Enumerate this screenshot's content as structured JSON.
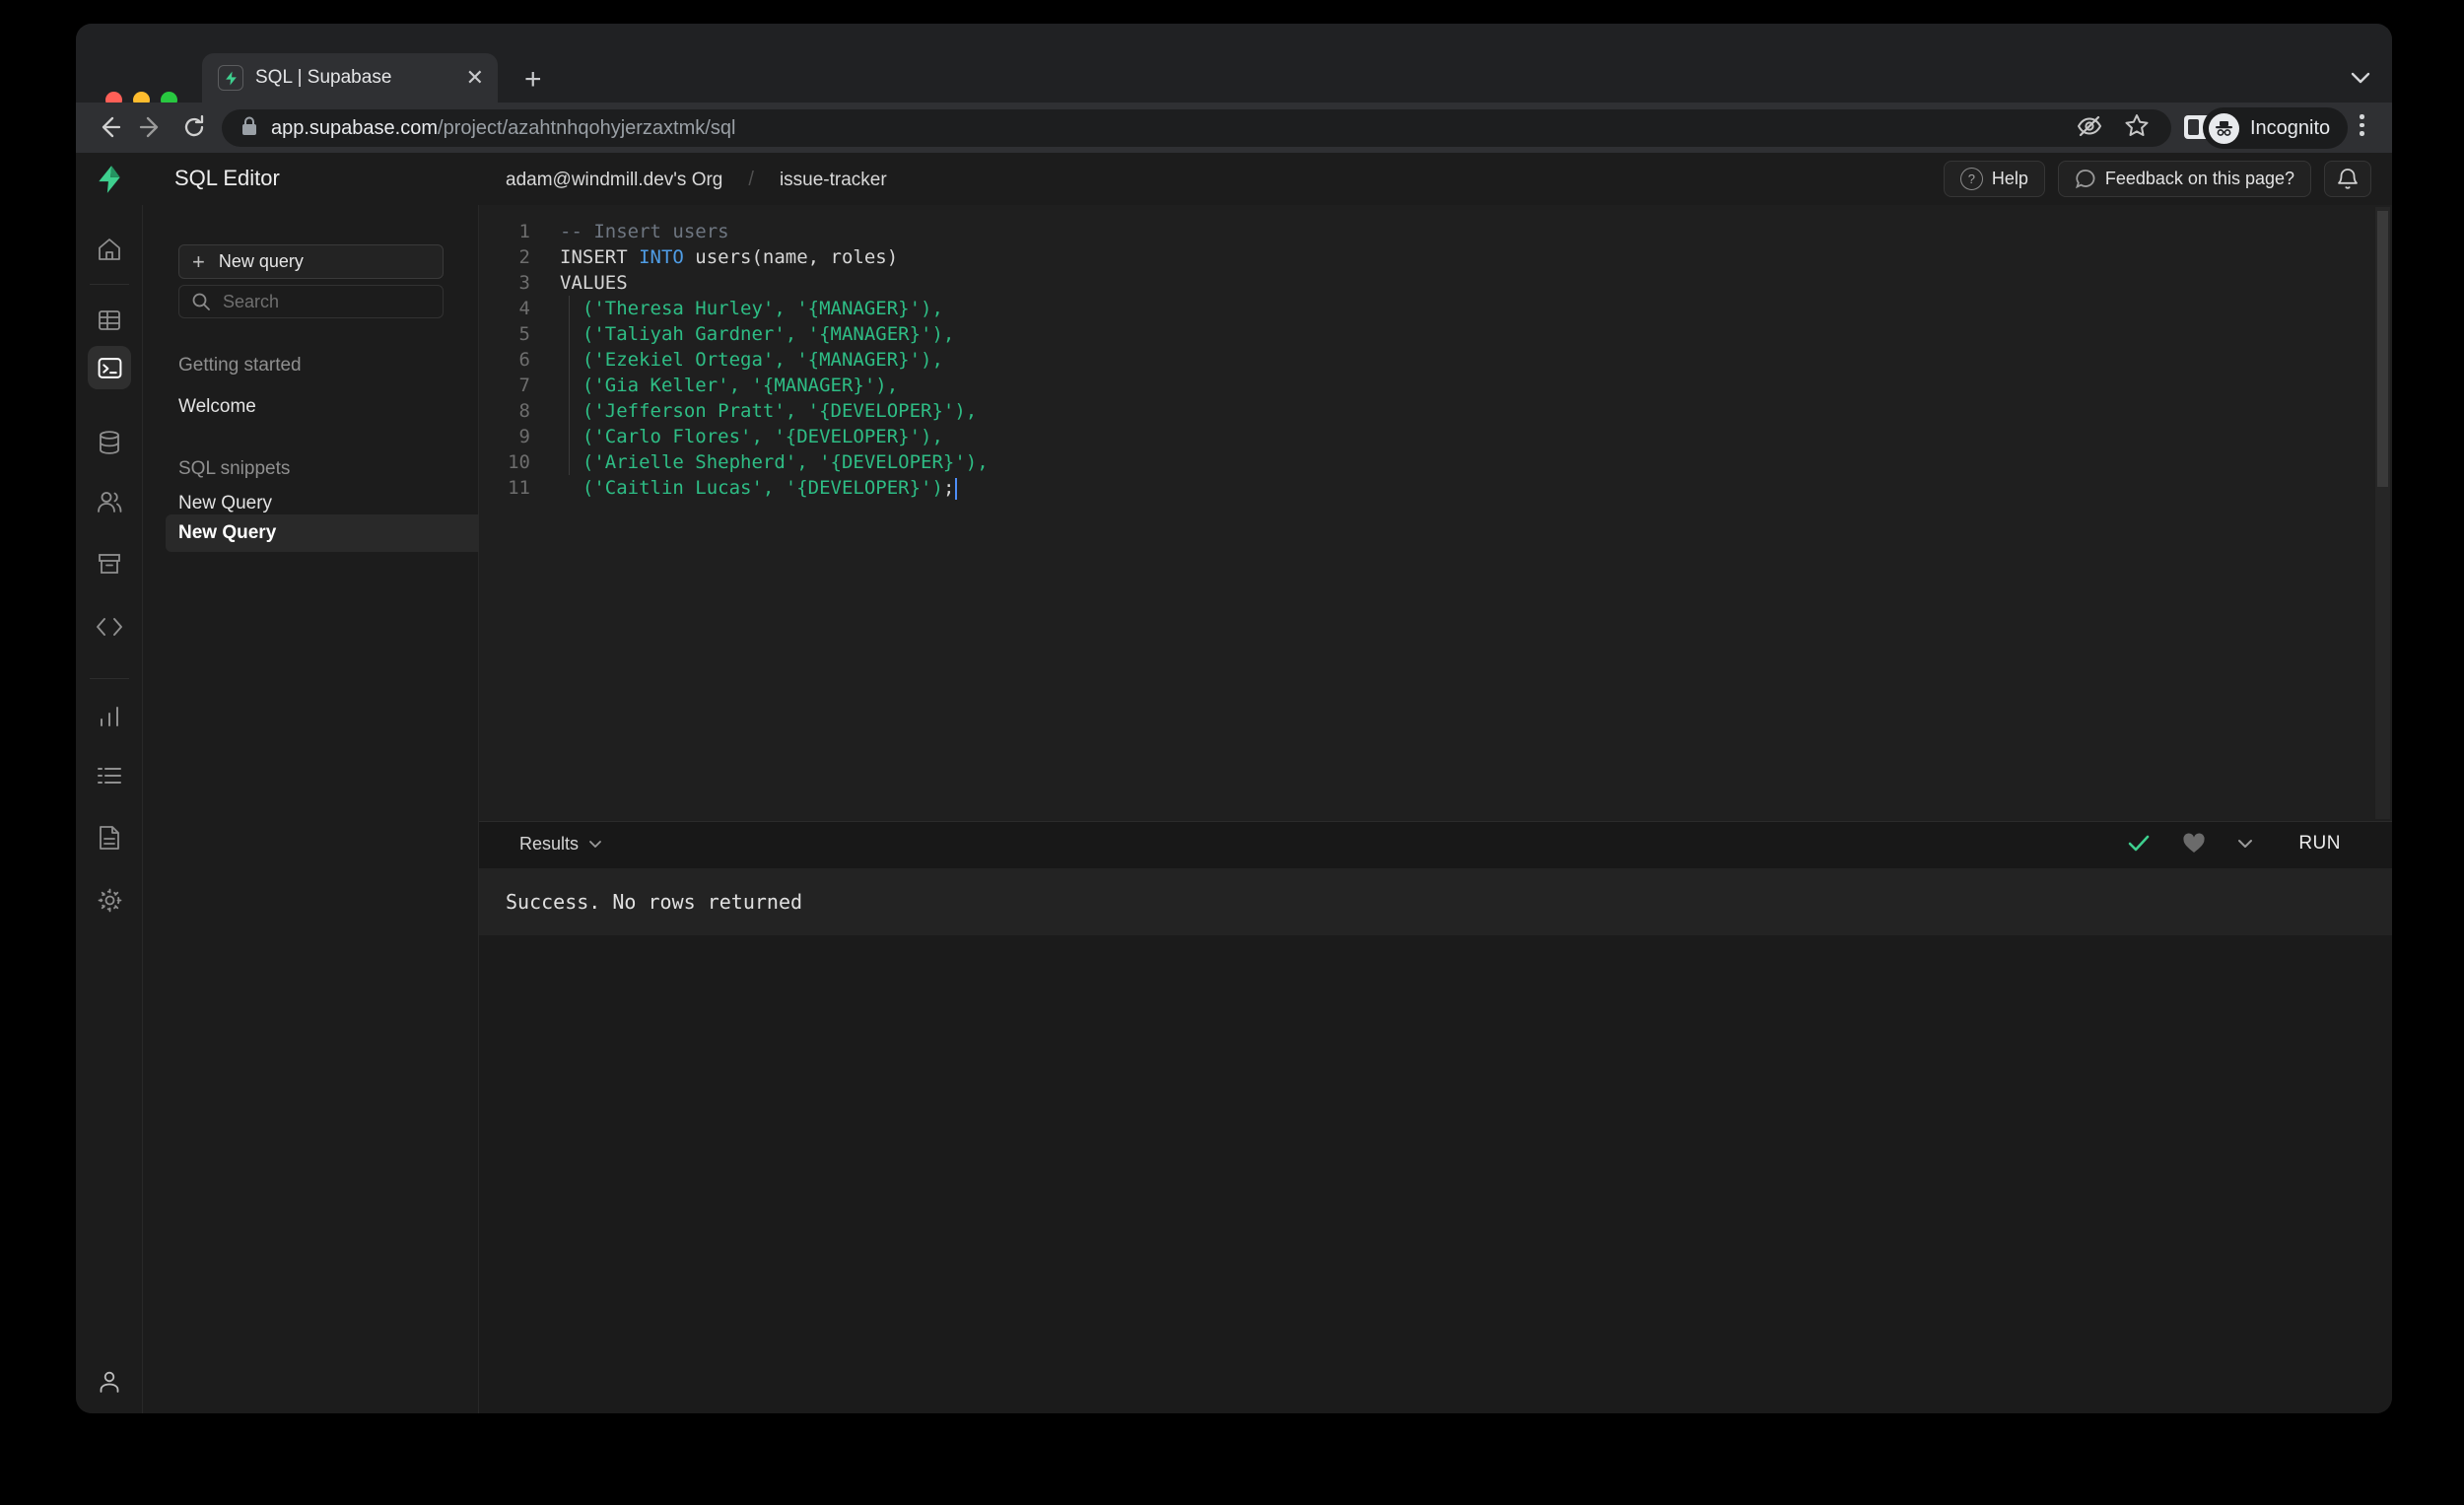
{
  "browser": {
    "tab_title": "SQL | Supabase",
    "url_host": "app.supabase.com",
    "url_path": "/project/azahtnhqohyjerzaxtmk/sql",
    "incognito_label": "Incognito"
  },
  "header": {
    "app_title": "SQL Editor",
    "breadcrumb": {
      "org": "adam@windmill.dev's Org",
      "separator": "/",
      "project": "issue-tracker"
    },
    "help_label": "Help",
    "feedback_label": "Feedback on this page?"
  },
  "sidebar": {
    "icons": [
      "home",
      "table-editor",
      "sql-editor",
      "database",
      "authentication",
      "storage",
      "edge-functions",
      "reports",
      "logs",
      "api-docs",
      "settings",
      "account"
    ],
    "selected": "sql-editor"
  },
  "query_panel": {
    "new_query_button": "New query",
    "search_placeholder": "Search",
    "getting_started": {
      "heading": "Getting started",
      "items": [
        {
          "label": "Welcome"
        }
      ]
    },
    "sql_snippets": {
      "heading": "SQL snippets",
      "items": [
        {
          "label": "New Query"
        },
        {
          "label": "New Query",
          "selected": true
        }
      ]
    }
  },
  "editor": {
    "lines": [
      {
        "num": 1,
        "segments": [
          {
            "type": "comment",
            "text": "-- Insert users"
          }
        ]
      },
      {
        "num": 2,
        "segments": [
          {
            "type": "plain",
            "text": "INSERT "
          },
          {
            "type": "keyword",
            "text": "INTO"
          },
          {
            "type": "plain",
            "text": " users(name, roles)"
          }
        ]
      },
      {
        "num": 3,
        "segments": [
          {
            "type": "plain",
            "text": "VALUES"
          }
        ]
      },
      {
        "num": 4,
        "segments": [
          {
            "type": "string",
            "text": "  ('Theresa Hurley', '{MANAGER}'),"
          }
        ]
      },
      {
        "num": 5,
        "segments": [
          {
            "type": "string",
            "text": "  ('Taliyah Gardner', '{MANAGER}'),"
          }
        ]
      },
      {
        "num": 6,
        "segments": [
          {
            "type": "string",
            "text": "  ('Ezekiel Ortega', '{MANAGER}'),"
          }
        ]
      },
      {
        "num": 7,
        "segments": [
          {
            "type": "string",
            "text": "  ('Gia Keller', '{MANAGER}'),"
          }
        ]
      },
      {
        "num": 8,
        "segments": [
          {
            "type": "string",
            "text": "  ('Jefferson Pratt', '{DEVELOPER}'),"
          }
        ]
      },
      {
        "num": 9,
        "segments": [
          {
            "type": "string",
            "text": "  ('Carlo Flores', '{DEVELOPER}'),"
          }
        ]
      },
      {
        "num": 10,
        "segments": [
          {
            "type": "string",
            "text": "  ('Arielle Shepherd', '{DEVELOPER}'),"
          }
        ]
      },
      {
        "num": 11,
        "segments": [
          {
            "type": "string",
            "text": "  ('Caitlin Lucas', '{DEVELOPER}')"
          },
          {
            "type": "plain",
            "text": ";"
          },
          {
            "type": "cursor"
          }
        ]
      }
    ]
  },
  "results": {
    "label": "Results",
    "run_label": "RUN",
    "status": "Success. No rows returned"
  },
  "colors": {
    "brand_green": "#3ecf8e",
    "string_green": "#2ebd85",
    "keyword_blue": "#4f9de6",
    "check_green": "#3ecf8e"
  }
}
